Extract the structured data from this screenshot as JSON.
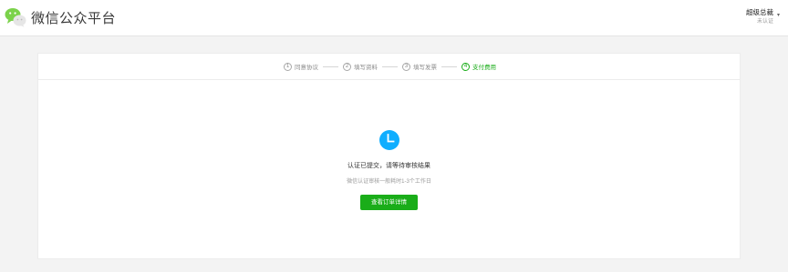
{
  "header": {
    "app_title": "微信公众平台",
    "account_name": "超级总裁",
    "account_status": "未认证"
  },
  "steps": [
    {
      "num": "1",
      "label": "同意协议",
      "active": false
    },
    {
      "num": "2",
      "label": "填写资料",
      "active": false
    },
    {
      "num": "3",
      "label": "填写发票",
      "active": false
    },
    {
      "num": "4",
      "label": "支付费用",
      "active": true
    }
  ],
  "result": {
    "icon": "clock-icon",
    "title": "认证已提交，请等待审核结果",
    "description": "微信认证审核一般耗时1-3个工作日",
    "button_label": "查看订单详情"
  },
  "colors": {
    "accent_green": "#1aad19",
    "clock_blue": "#10aeff",
    "page_bg": "#f3f3f3"
  }
}
